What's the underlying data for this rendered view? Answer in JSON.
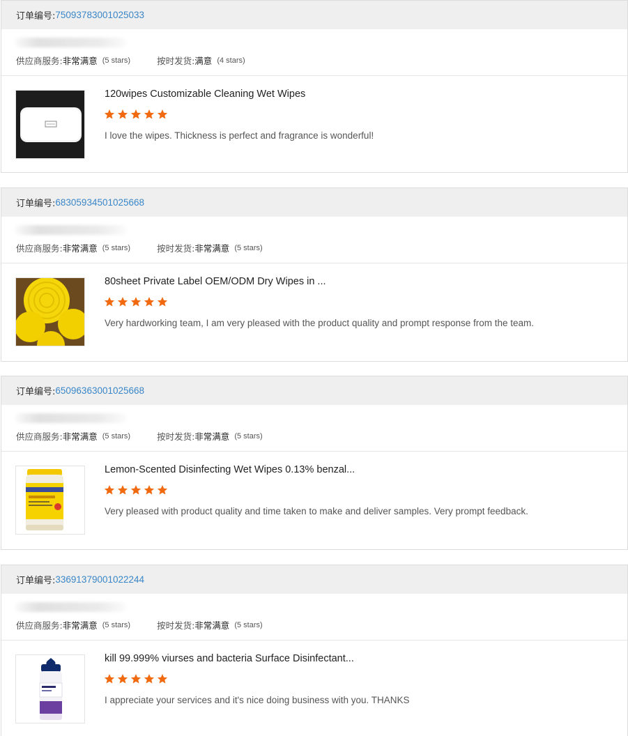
{
  "orders": [
    {
      "order_label": "订单编号:",
      "order_number": "75093783001025033",
      "supplier_label": "供应商服务:",
      "supplier_value": "非常满意",
      "supplier_stars": "(5 stars)",
      "delivery_label": "按时发货:",
      "delivery_value": "满意",
      "delivery_stars": "(4 stars)",
      "product_title": "120wipes Customizable Cleaning Wet Wipes",
      "rating": 5,
      "comment": "I love the wipes. Thickness is perfect and fragrance is wonderful!"
    },
    {
      "order_label": "订单编号:",
      "order_number": "68305934501025668",
      "supplier_label": "供应商服务:",
      "supplier_value": "非常满意",
      "supplier_stars": "(5 stars)",
      "delivery_label": "按时发货:",
      "delivery_value": "非常满意",
      "delivery_stars": "(5 stars)",
      "product_title": "80sheet Private Label OEM/ODM Dry Wipes in ...",
      "rating": 5,
      "comment": "Very hardworking team, I am very pleased with the product quality and prompt response from the team."
    },
    {
      "order_label": "订单编号:",
      "order_number": "65096363001025668",
      "supplier_label": "供应商服务:",
      "supplier_value": "非常满意",
      "supplier_stars": "(5 stars)",
      "delivery_label": "按时发货:",
      "delivery_value": "非常满意",
      "delivery_stars": "(5 stars)",
      "product_title": "Lemon-Scented Disinfecting Wet Wipes 0.13% benzal...",
      "rating": 5,
      "comment": "Very pleased with product quality and time taken to make and deliver samples. Very prompt feedback."
    },
    {
      "order_label": "订单编号:",
      "order_number": "33691379001022244",
      "supplier_label": "供应商服务:",
      "supplier_value": "非常满意",
      "supplier_stars": "(5 stars)",
      "delivery_label": "按时发货:",
      "delivery_value": "非常满意",
      "delivery_stars": "(5 stars)",
      "product_title": "kill 99.999% viurses and bacteria Surface Disinfectant...",
      "rating": 5,
      "comment": "I appreciate your services and it's nice doing business with you.  THANKS"
    }
  ],
  "colors": {
    "star": "#f26a10",
    "order_link": "#3a86c8",
    "header_bg": "#efefef"
  }
}
